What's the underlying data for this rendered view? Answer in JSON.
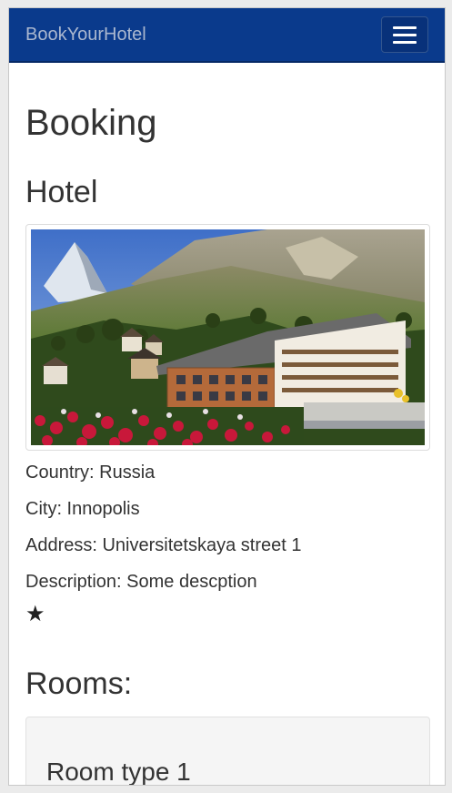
{
  "navbar": {
    "brand": "BookYourHotel",
    "menu_icon": "hamburger-menu-icon"
  },
  "page": {
    "title": "Booking"
  },
  "hotel": {
    "heading": "Hotel",
    "image_alt": "hotel-photo",
    "country_line": "Country: Russia",
    "city_line": "City: Innopolis",
    "address_line": "Address: Universitetskaya street 1",
    "description_line": "Description: Some descption",
    "rating_stars": "★"
  },
  "rooms": {
    "heading": "Rooms:",
    "items": [
      {
        "title": "Room type 1"
      }
    ]
  },
  "colors": {
    "navbar_bg": "#0a3a8c",
    "brand_text": "#aab7cf",
    "card_bg": "#f5f5f5"
  }
}
